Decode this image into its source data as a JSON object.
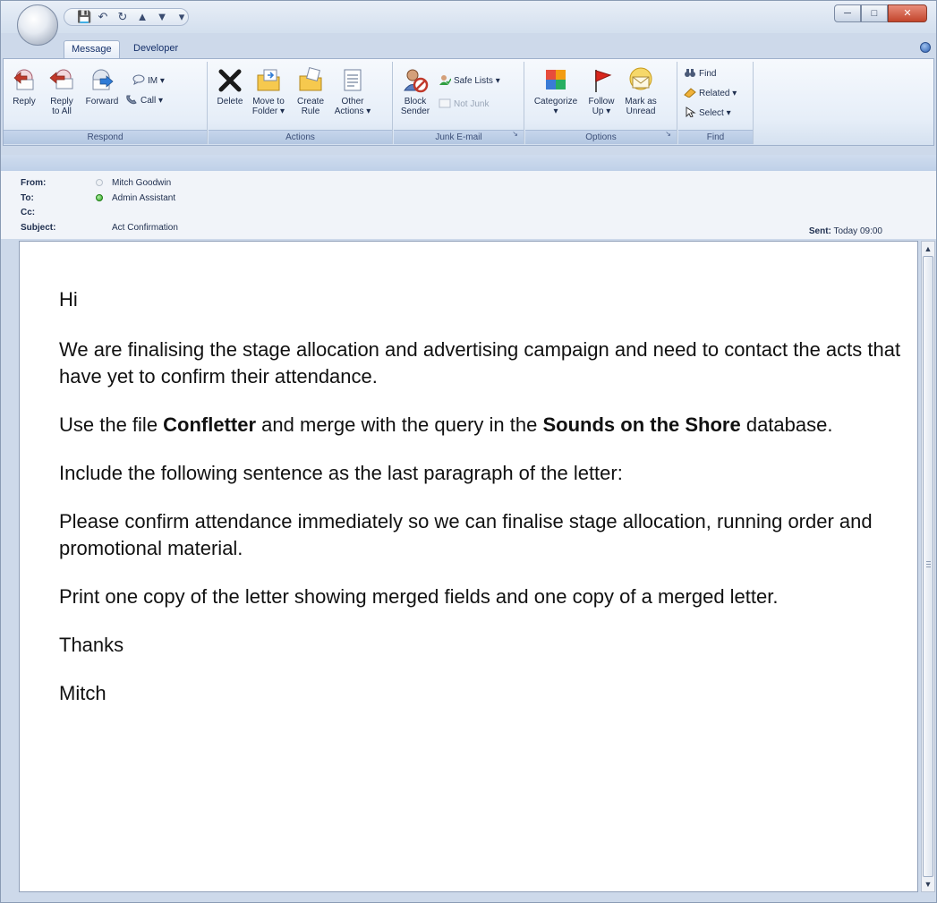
{
  "tabs": [
    {
      "label": "Message",
      "active": true
    },
    {
      "label": "Developer",
      "active": false
    }
  ],
  "ribbon": {
    "respond": {
      "label": "Respond",
      "reply": "Reply",
      "reply_all_line1": "Reply",
      "reply_all_line2": "to All",
      "forward": "Forward",
      "im": "IM",
      "call": "Call"
    },
    "actions": {
      "label": "Actions",
      "delete": "Delete",
      "move_line1": "Move to",
      "move_line2": "Folder",
      "create_line1": "Create",
      "create_line2": "Rule",
      "other_line1": "Other",
      "other_line2": "Actions"
    },
    "junk": {
      "label": "Junk E-mail",
      "block_line1": "Block",
      "block_line2": "Sender",
      "safe_lists": "Safe Lists",
      "not_junk": "Not Junk"
    },
    "options": {
      "label": "Options",
      "categorize": "Categorize",
      "follow_line1": "Follow",
      "follow_line2": "Up",
      "mark_line1": "Mark as",
      "mark_line2": "Unread"
    },
    "find": {
      "label": "Find",
      "find": "Find",
      "related": "Related",
      "select": "Select"
    }
  },
  "header": {
    "from_label": "From:",
    "from_value": "Mitch Goodwin",
    "to_label": "To:",
    "to_value": "Admin Assistant",
    "cc_label": "Cc:",
    "subject_label": "Subject:",
    "subject_value": "Act Confirmation",
    "sent_label": "Sent:",
    "sent_value": "Today 09:00"
  },
  "body": {
    "greeting": "Hi",
    "p1": "We are finalising the stage allocation and advertising campaign and need to contact the acts that have yet to confirm their attendance.",
    "p2_a": "Use the file ",
    "p2_bold1": "Confletter",
    "p2_b": " and merge with the query in the ",
    "p2_bold2": "Sounds on the Shore",
    "p2_c": " database.",
    "p3": "Include the following sentence as the last paragraph of the letter:",
    "p4": "Please confirm attendance immediately so we can finalise stage allocation, running order and promotional material.",
    "p5": "Print one copy of the letter showing merged fields and one copy of a merged letter.",
    "thanks": "Thanks",
    "signature": "Mitch"
  },
  "colors": {
    "accent": "#15306a",
    "ribbon_label_bg": "#b3c6e1",
    "presence_online": "#2aa31d",
    "close_button": "#c3452c"
  }
}
